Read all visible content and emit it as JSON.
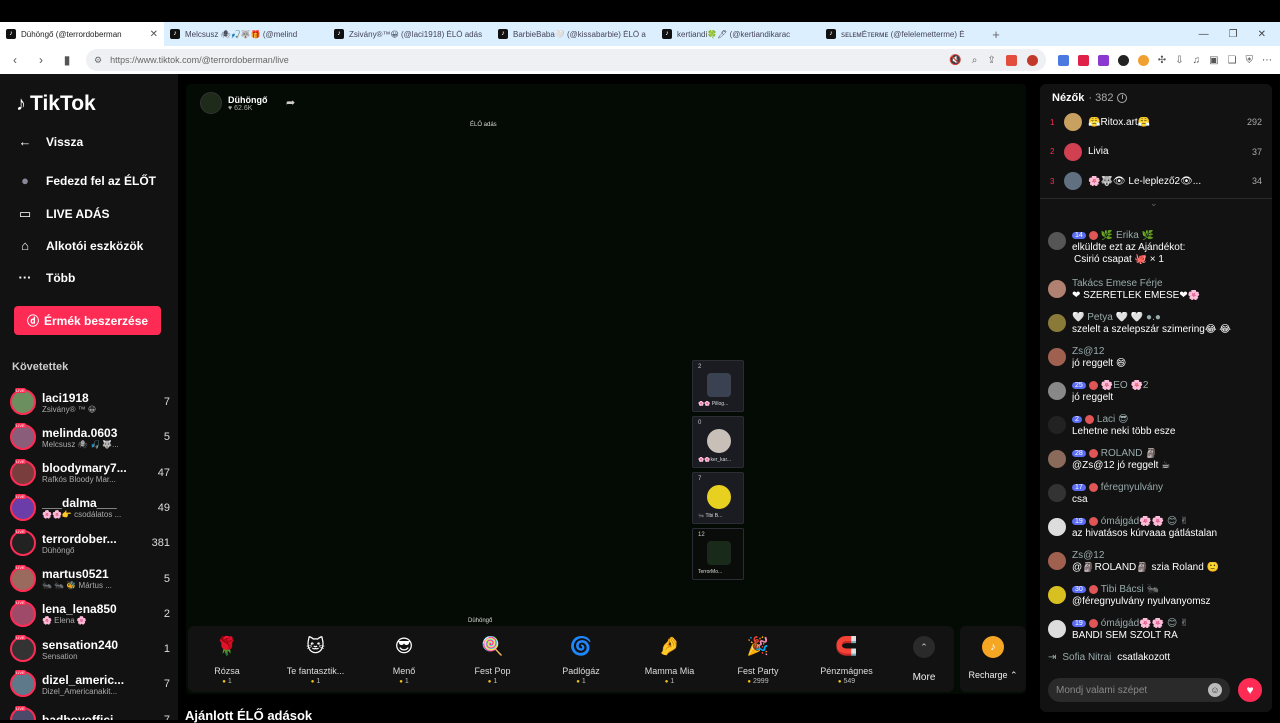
{
  "browser": {
    "tabs": [
      {
        "title": "Dühöngő (@terrordoberman",
        "active": true
      },
      {
        "title": "Melcsusz 🕷🎣🐺🎁 (@melind",
        "active": false
      },
      {
        "title": "Zsivány®™😀 (@laci1918) ÉLŐ adás",
        "active": false
      },
      {
        "title": "BarbieBaba🤍 (@kissabarbie) ÉLŐ a",
        "active": false
      },
      {
        "title": "kertiandi🍀🖊 (@kertiandikarac",
        "active": false
      },
      {
        "title": "ꜱᴇʟᴇᴍÉᴛᴇʀᴍᴇ (@felelemetterme) É",
        "active": false
      }
    ],
    "close_glyph": "✕",
    "new_tab_glyph": "+",
    "url": "https://www.tiktok.com/@terrordoberman/live"
  },
  "sidebar": {
    "logo": "TikTok",
    "nav": [
      {
        "label": "Vissza",
        "icon": "←"
      },
      {
        "label": "Fedezd fel az ÉLŐT",
        "icon": "●"
      },
      {
        "label": "LIVE ADÁS",
        "icon": "▭"
      },
      {
        "label": "Alkotói eszközök",
        "icon": "⌂"
      },
      {
        "label": "Több",
        "icon": "···"
      }
    ],
    "coins_button": "Érmék beszerzése",
    "following_title": "Követettek",
    "live_badge": "LIVE",
    "following": [
      {
        "name": "laci1918",
        "sub": "Zsivány® ™ 😀",
        "count": "7",
        "color": "#6b8f5e"
      },
      {
        "name": "melinda.0603",
        "sub": "Melcsusz 🕷 🎣 🐺...",
        "count": "5",
        "color": "#8a5e7a"
      },
      {
        "name": "bloodymary7...",
        "sub": "Rafkós Bloody Mar...",
        "count": "47",
        "color": "#7a3d3d"
      },
      {
        "name": "___dalma___",
        "sub": "🌸🌸👉 csodálatos ...",
        "count": "49",
        "color": "#6a3da8"
      },
      {
        "name": "terrordober...",
        "sub": "Dühöngő",
        "count": "381",
        "color": "#222"
      },
      {
        "name": "martus0521",
        "sub": "🐜 🐜 🐝 Mártus ...",
        "count": "5",
        "color": "#9a6a5e"
      },
      {
        "name": "lena_lena850",
        "sub": "🌸 Elena 🌸",
        "count": "2",
        "color": "#a04a6a"
      },
      {
        "name": "sensation240",
        "sub": "Sensation",
        "count": "1",
        "color": "#333"
      },
      {
        "name": "dizel_americ...",
        "sub": "Dizel_Americanakit...",
        "count": "7",
        "color": "#5e7a8a"
      },
      {
        "name": "badboyoffici...",
        "sub": "",
        "count": "7",
        "color": "#4a4a6a"
      }
    ]
  },
  "stream": {
    "streamer_name": "Dühöngő",
    "likes": "♥ 62.6K",
    "live_label": "ÉLŐ adás",
    "bottom_name": "Dühöngő",
    "guests": [
      {
        "num": "2",
        "name": "🌸🌸 Pillog..."
      },
      {
        "num": "0",
        "name": "🌸🌸ker_kar..."
      },
      {
        "num": "7",
        "name": "🐜 Tibi B..."
      },
      {
        "num": "12",
        "name": "TerrorMo..."
      }
    ],
    "gifts": [
      {
        "label": "Rózsa",
        "price": "1",
        "icon": "🌹"
      },
      {
        "label": "Te fantasztik...",
        "price": "1",
        "icon": "🐱"
      },
      {
        "label": "Menő",
        "price": "1",
        "icon": "😎"
      },
      {
        "label": "Fest Pop",
        "price": "1",
        "icon": "🍭"
      },
      {
        "label": "Padlógáz",
        "price": "1",
        "icon": "🌀"
      },
      {
        "label": "Mamma Mia",
        "price": "1",
        "icon": "🤌"
      },
      {
        "label": "Fest Party",
        "price": "2999",
        "icon": "🎉"
      },
      {
        "label": "Pénzmágnes",
        "price": "549",
        "icon": "🧲"
      }
    ],
    "more_label": "More",
    "recharge_label": "Recharge ⌃",
    "recommended_title": "Ajánlott ÉLŐ adások"
  },
  "chat": {
    "viewers_title": "Nézők",
    "viewers_count": "· 382",
    "top_viewers": [
      {
        "rank": "1",
        "name": "😤Ritox.art😤",
        "score": "292",
        "color": "#c8a060"
      },
      {
        "rank": "2",
        "name": "Livia",
        "score": "37",
        "color": "#d04050"
      },
      {
        "rank": "3",
        "name": "🌸🐺👁 Le-leplező2👁...",
        "score": "34",
        "color": "#607080"
      }
    ],
    "messages": [
      {
        "level": "14",
        "user": "🌿 Erika 🌿",
        "text": "elküldte ezt az Ajándékot:",
        "text2": "Csirió csapat 🐙 × 1",
        "color": "#555"
      },
      {
        "level": "",
        "user": "Takács Emese Férje",
        "text": "❤ SZERETLEK EMESE❤🌸",
        "color": "#b08070"
      },
      {
        "level": "",
        "user": "🤍 Petya 🤍 🤍 ●.●",
        "text": "szelelt a szelepszár szimering😂 😂",
        "color": "#8a7a3a"
      },
      {
        "level": "",
        "user": "Zs@12",
        "text": "jó reggelt 😄",
        "color": "#a06050"
      },
      {
        "level": "25",
        "user": "🌸EO 🌸2",
        "text": "jó reggelt",
        "color": "#888"
      },
      {
        "level": "2",
        "user": "Laci 😎",
        "text": "Lehetne neki több esze",
        "color": "#222"
      },
      {
        "level": "28",
        "user": "ROLAND 🗿",
        "text": "@Zs@12 jó reggelt ☕",
        "color": "#8a6a5a"
      },
      {
        "level": "17",
        "user": "féregnyulvány",
        "text": "csa",
        "color": "#333"
      },
      {
        "level": "19",
        "user": "ómájgád🌸🌸 😊 ✌",
        "text": "az hivatásos kúrvaaa gátlástalan",
        "color": "#ddd"
      },
      {
        "level": "",
        "user": "Zs@12",
        "text": "@🗿ROLAND🗿 szia Roland 🙂",
        "color": "#a06050"
      },
      {
        "level": "30",
        "user": "Tibi Bácsi 🐜",
        "text": "@féregnyulvány nyulvanyomsz",
        "color": "#d8c020"
      },
      {
        "level": "19",
        "user": "ómájgád🌸🌸 😊 ✌",
        "text": "BANDI SEM SZOLT RÁ",
        "color": "#ddd"
      }
    ],
    "joined_user": "Sofia Nitrai",
    "joined_text": "csatlakozott",
    "input_placeholder": "Mondj valami szépet"
  }
}
